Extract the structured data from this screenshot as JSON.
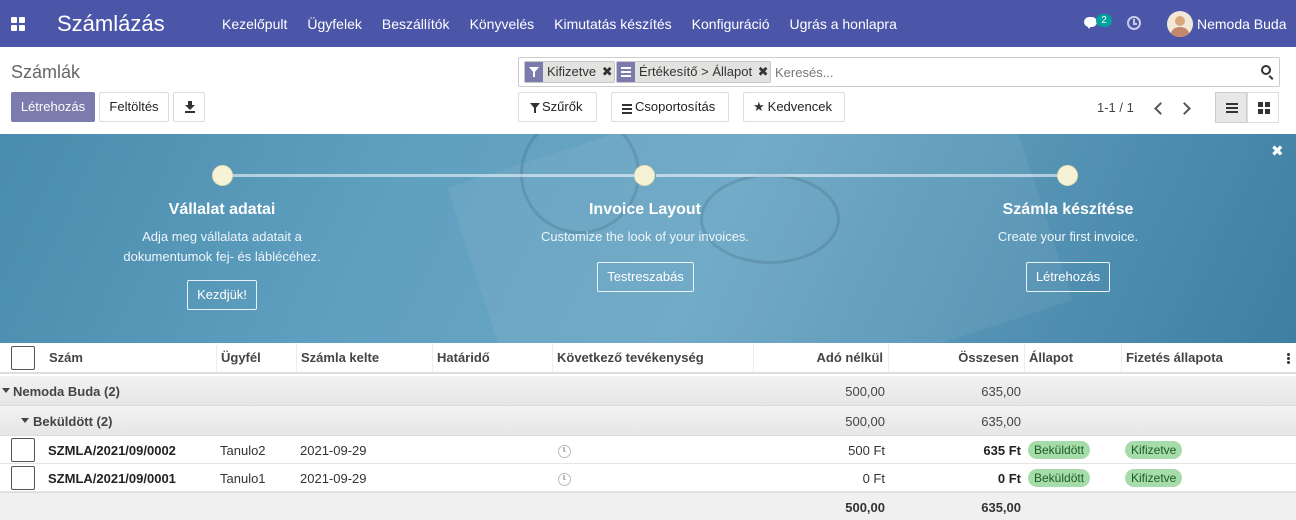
{
  "navbar": {
    "app_title": "Számlázás",
    "menu": [
      "Kezelőpult",
      "Ügyfelek",
      "Beszállítók",
      "Könyvelés",
      "Kimutatás készítés",
      "Konfiguráció",
      "Ugrás a honlapra"
    ],
    "chat_count": "2",
    "user_name": "Nemoda Buda",
    "brand_color": "#4c56a8"
  },
  "control": {
    "breadcrumb": "Számlák",
    "create_label": "Létrehozás",
    "upload_label": "Feltöltés",
    "search": {
      "facets": [
        {
          "icon": "filter-icon",
          "label": "Kifizetve"
        },
        {
          "icon": "group-by-icon",
          "label": "Értékesítő > Állapot"
        }
      ],
      "placeholder": "Keresés..."
    },
    "filters_label": "Szűrők",
    "groupby_label": "Csoportosítás",
    "favorites_label": "Kedvencek",
    "pager": "1-1 / 1"
  },
  "onboarding": {
    "steps": [
      {
        "title": "Vállalat adatai",
        "desc_line1": "Adja meg vállalata adatait a",
        "desc_line2": "dokumentumok fej- és láblécéhez.",
        "button": "Kezdjük!"
      },
      {
        "title": "Invoice Layout",
        "desc_line1": "Customize the look of your invoices.",
        "desc_line2": "",
        "button": "Testreszabás"
      },
      {
        "title": "Számla készítése",
        "desc_line1": "Create your first invoice.",
        "desc_line2": "",
        "button": "Létrehozás"
      }
    ]
  },
  "table": {
    "columns": {
      "number": "Szám",
      "customer": "Ügyfél",
      "invoice_date": "Számla kelte",
      "due_date": "Határidő",
      "next_activity": "Következő tevékenység",
      "untaxed": "Adó nélkül",
      "total": "Összesen",
      "state": "Állapot",
      "payment_state": "Fizetés állapota"
    },
    "groups": [
      {
        "label": "Nemoda Buda (2)",
        "untaxed": "500,00",
        "total": "635,00"
      },
      {
        "label": "Beküldött (2)",
        "untaxed": "500,00",
        "total": "635,00"
      }
    ],
    "rows": [
      {
        "number": "SZMLA/2021/09/0002",
        "customer": "Tanulo2",
        "invoice_date": "2021-09-29",
        "untaxed": "500 Ft",
        "total": "635 Ft",
        "state": "Beküldött",
        "payment_state": "Kifizetve"
      },
      {
        "number": "SZMLA/2021/09/0001",
        "customer": "Tanulo1",
        "invoice_date": "2021-09-29",
        "untaxed": "0 Ft",
        "total": "0 Ft",
        "state": "Beküldött",
        "payment_state": "Kifizetve"
      }
    ],
    "footer": {
      "untaxed": "500,00",
      "total": "635,00"
    },
    "badge_color": "#a6dcaa"
  }
}
